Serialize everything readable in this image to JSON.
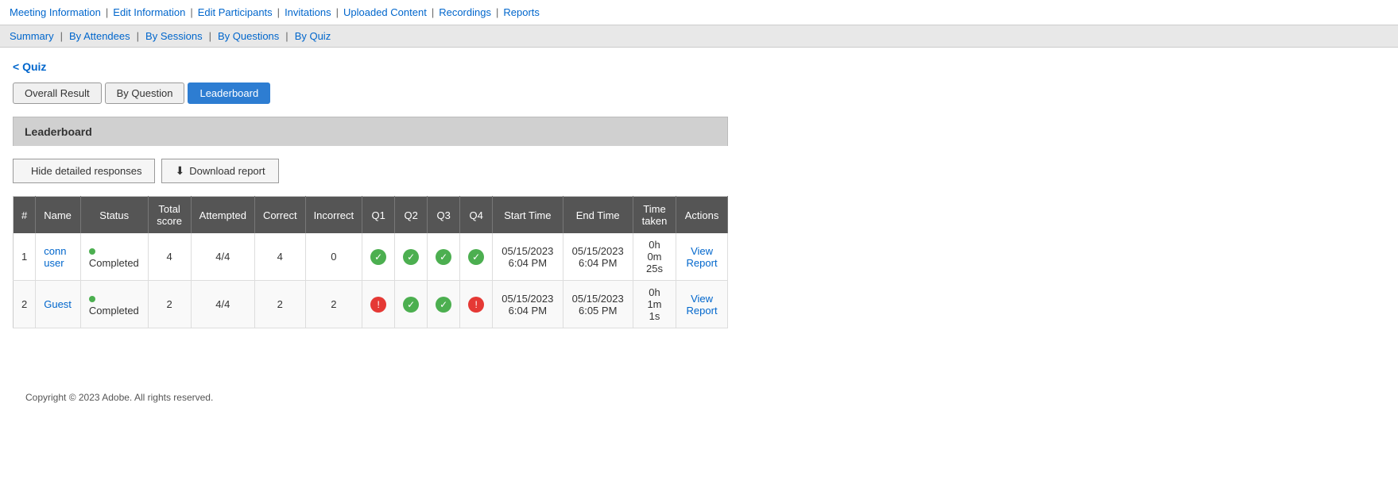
{
  "topNav": {
    "items": [
      {
        "label": "Meeting Information",
        "href": "#"
      },
      {
        "label": "Edit Information",
        "href": "#"
      },
      {
        "label": "Edit Participants",
        "href": "#"
      },
      {
        "label": "Invitations",
        "href": "#"
      },
      {
        "label": "Uploaded Content",
        "href": "#"
      },
      {
        "label": "Recordings",
        "href": "#"
      },
      {
        "label": "Reports",
        "href": "#"
      }
    ]
  },
  "subNav": {
    "items": [
      {
        "label": "Summary",
        "href": "#"
      },
      {
        "label": "By Attendees",
        "href": "#"
      },
      {
        "label": "By Sessions",
        "href": "#"
      },
      {
        "label": "By Questions",
        "href": "#"
      },
      {
        "label": "By Quiz",
        "href": "#",
        "noPipe": true
      }
    ]
  },
  "backLink": {
    "label": "< Quiz"
  },
  "tabs": [
    {
      "label": "Overall Result",
      "active": false
    },
    {
      "label": "By Question",
      "active": false
    },
    {
      "label": "Leaderboard",
      "active": true
    }
  ],
  "leaderboard": {
    "title": "Leaderboard"
  },
  "buttons": {
    "hideDetailed": "Hide detailed responses",
    "downloadReport": "Download report"
  },
  "table": {
    "columns": [
      "#",
      "Name",
      "Status",
      "Total score",
      "Attempted",
      "Correct",
      "Incorrect",
      "Q1",
      "Q2",
      "Q3",
      "Q4",
      "Start Time",
      "End Time",
      "Time taken",
      "Actions"
    ],
    "rows": [
      {
        "num": "1",
        "name": "conn user",
        "status": "Completed",
        "totalScore": "4",
        "attempted": "4/4",
        "correct": "4",
        "incorrect": "0",
        "q1": "correct",
        "q2": "correct",
        "q3": "correct",
        "q4": "correct",
        "startTime": "05/15/2023 6:04 PM",
        "endTime": "05/15/2023 6:04 PM",
        "timeTaken": "0h 0m 25s",
        "actionLabel": "View Report"
      },
      {
        "num": "2",
        "name": "Guest",
        "status": "Completed",
        "totalScore": "2",
        "attempted": "4/4",
        "correct": "2",
        "incorrect": "2",
        "q1": "incorrect",
        "q2": "correct",
        "q3": "correct",
        "q4": "incorrect",
        "startTime": "05/15/2023 6:04 PM",
        "endTime": "05/15/2023 6:05 PM",
        "timeTaken": "0h 1m 1s",
        "actionLabel": "View Report"
      }
    ]
  },
  "footer": {
    "text": "Copyright © 2023 Adobe. All rights reserved."
  }
}
